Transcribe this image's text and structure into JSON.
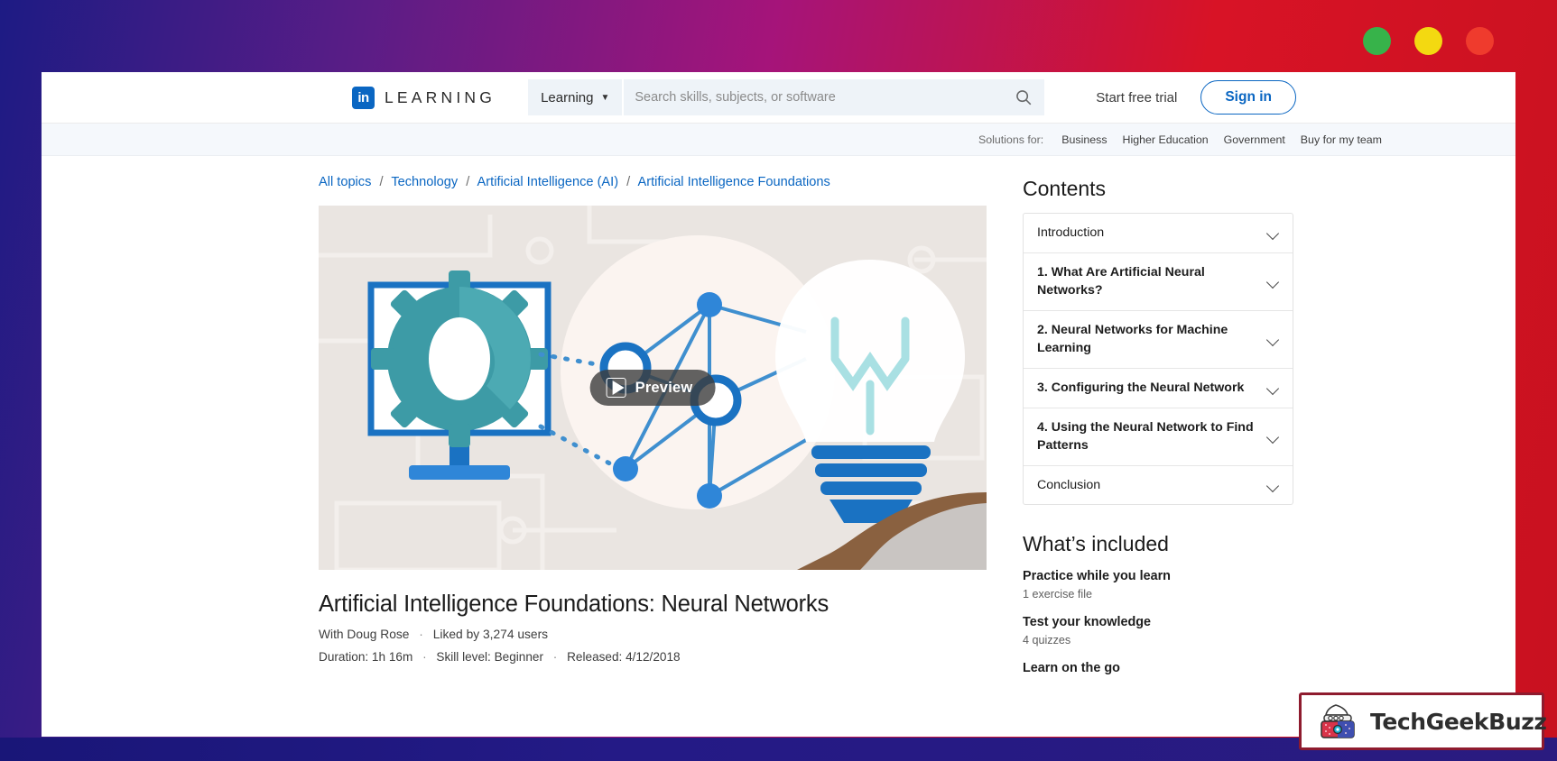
{
  "window": {
    "dots": [
      "green",
      "yellow",
      "red"
    ]
  },
  "topnav": {
    "logo_mark": "in",
    "logo_text": "LEARNING",
    "learning_dropdown": "Learning",
    "search_placeholder": "Search skills, subjects, or software",
    "search_value": "",
    "search_icon": "search-icon",
    "free_trial": "Start free trial",
    "sign_in": "Sign in"
  },
  "subnav": {
    "lead": "Solutions for:",
    "links": [
      "Business",
      "Higher Education",
      "Government",
      "Buy for my team"
    ]
  },
  "breadcrumb": {
    "items": [
      "All topics",
      "Technology",
      "Artificial Intelligence (AI)",
      "Artificial Intelligence Foundations"
    ],
    "separator": "/"
  },
  "hero": {
    "preview_label": "Preview",
    "play_icon": "play-icon"
  },
  "course": {
    "title": "Artificial Intelligence Foundations: Neural Networks",
    "author": "With Doug Rose",
    "likes": "Liked by 3,274 users",
    "duration": "Duration: 1h 16m",
    "skill_level": "Skill level: Beginner",
    "released": "Released: 4/12/2018",
    "separator": "·"
  },
  "contents": {
    "title": "Contents",
    "chevron_icon": "chevron-down-icon",
    "items": [
      {
        "label": "Introduction",
        "bold": false
      },
      {
        "label": "1. What Are Artificial Neural Networks?",
        "bold": true
      },
      {
        "label": "2. Neural Networks for Machine Learning",
        "bold": true
      },
      {
        "label": "3. Configuring the Neural Network",
        "bold": true
      },
      {
        "label": "4. Using the Neural Network to Find Patterns",
        "bold": true
      },
      {
        "label": "Conclusion",
        "bold": false
      }
    ]
  },
  "whats_included": {
    "title": "What’s included",
    "items": [
      {
        "label": "Practice while you learn",
        "sub": "1 exercise file"
      },
      {
        "label": "Test your knowledge",
        "sub": "4 quizzes"
      },
      {
        "label": "Learn on the go",
        "sub": ""
      }
    ]
  },
  "watermark": {
    "text": "TechGeekBuzz",
    "logo_icon": "techgeekbuzz-robot-icon"
  },
  "colors": {
    "linkedin_blue": "#0a66c2",
    "frame_red": "#c8111f",
    "frame_purple": "#5b1d86",
    "frame_navy": "#1d1b84",
    "watermark_border": "#8e1b2e"
  }
}
